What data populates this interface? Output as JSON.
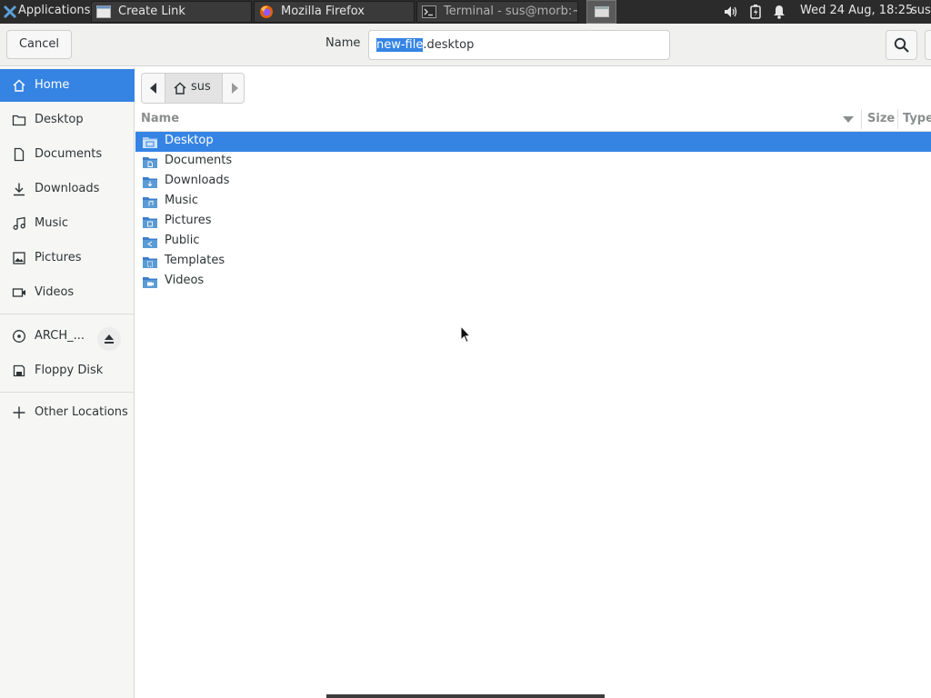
{
  "panel": {
    "apps_label": "Applications",
    "tasks": [
      {
        "label": "Create Link",
        "icon": "window-icon"
      },
      {
        "label": "Mozilla Firefox",
        "icon": "firefox-icon"
      },
      {
        "label": "Terminal - sus@morb:~",
        "icon": "terminal-icon"
      }
    ],
    "clock": "Wed 24 Aug, 18:25",
    "user": "sus"
  },
  "header": {
    "cancel_label": "Cancel",
    "name_label": "Name",
    "filename_selected": "new-file",
    "filename_rest": ".desktop"
  },
  "sidebar": {
    "items": [
      {
        "label": "Home",
        "icon": "home-icon",
        "active": true
      },
      {
        "label": "Desktop",
        "icon": "folder-icon"
      },
      {
        "label": "Documents",
        "icon": "document-icon"
      },
      {
        "label": "Downloads",
        "icon": "download-icon"
      },
      {
        "label": "Music",
        "icon": "music-icon"
      },
      {
        "label": "Pictures",
        "icon": "picture-icon"
      },
      {
        "label": "Videos",
        "icon": "video-icon"
      },
      {
        "label": "ARCH_...",
        "icon": "optical-disc-icon"
      },
      {
        "label": "Floppy Disk",
        "icon": "floppy-icon"
      },
      {
        "label": "Other Locations",
        "icon": "plus-icon"
      }
    ]
  },
  "pathbar": {
    "crumb": "sus"
  },
  "columns": {
    "name": "Name",
    "size": "Size",
    "type": "Type"
  },
  "files": [
    {
      "name": "Desktop",
      "selected": true
    },
    {
      "name": "Documents"
    },
    {
      "name": "Downloads"
    },
    {
      "name": "Music"
    },
    {
      "name": "Pictures"
    },
    {
      "name": "Public"
    },
    {
      "name": "Templates"
    },
    {
      "name": "Videos"
    }
  ],
  "colors": {
    "accent": "#3584e4",
    "panel_bg": "#2b2b2b",
    "folder": "#5b9bd5"
  }
}
